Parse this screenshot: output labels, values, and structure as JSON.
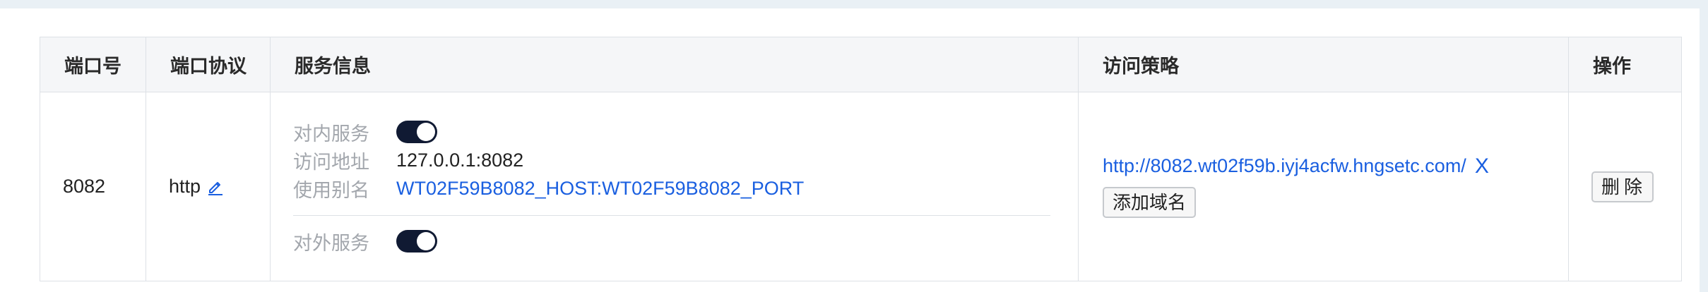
{
  "table": {
    "headers": {
      "port": "端口号",
      "protocol": "端口协议",
      "service": "服务信息",
      "policy": "访问策略",
      "operation": "操作"
    },
    "row": {
      "port": "8082",
      "protocol": "http",
      "service": {
        "internal_label": "对内服务",
        "internal_enabled": true,
        "address_label": "访问地址",
        "address_value": "127.0.0.1:8082",
        "alias_label": "使用别名",
        "alias_value": "WT02F59B8082_HOST:WT02F59B8082_PORT",
        "external_label": "对外服务",
        "external_enabled": true
      },
      "policy": {
        "domain": "http://8082.wt02f59b.iyj4acfw.hngsetc.com/",
        "remove_icon": "X",
        "add_domain_label": "添加域名"
      },
      "operation": {
        "delete_label": "删除"
      }
    }
  },
  "colors": {
    "link": "#1a5fe0",
    "toggle_on": "#101a33",
    "label_gray": "#a3a7ad",
    "header_bg": "#f5f6f8",
    "border": "#dde1e6"
  },
  "icons": {
    "edit": "pencil-edit-icon",
    "remove": "close-x-icon"
  }
}
